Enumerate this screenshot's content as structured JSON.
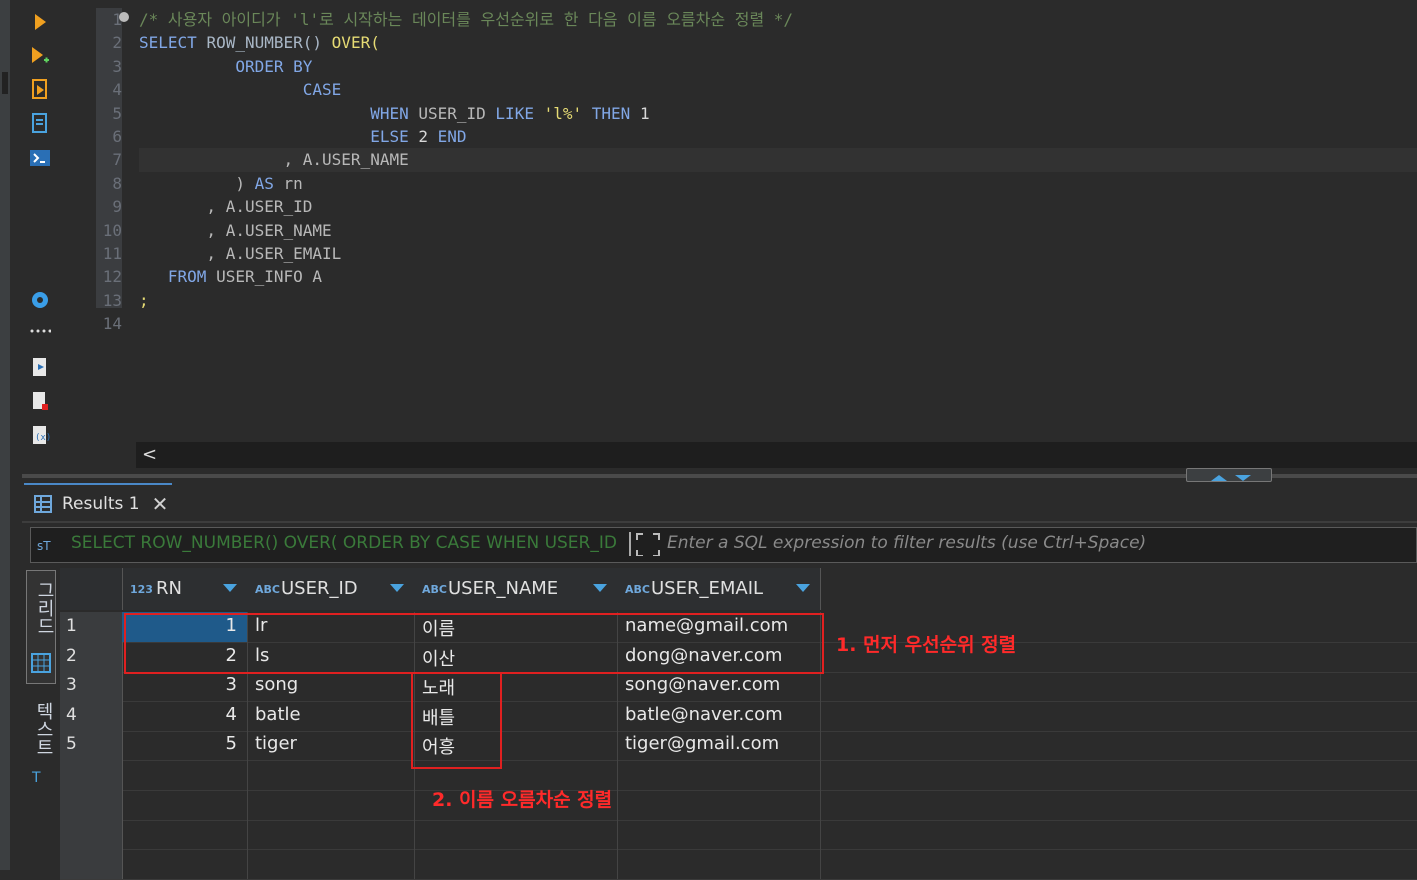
{
  "editor": {
    "lines": [
      {
        "n": "1",
        "parts": [
          {
            "c": "cm",
            "t": "/* 사용자 아이디가 'l'로 시작하는 데이터를 우선순위로 한 다음 이름 오름차순 정렬 */"
          }
        ]
      },
      {
        "n": "2",
        "parts": [
          {
            "c": "kw",
            "t": "SELECT "
          },
          {
            "c": "fn",
            "t": "ROW_NUMBER() "
          },
          {
            "c": "str",
            "t": "OVER("
          }
        ]
      },
      {
        "n": "3",
        "parts": [
          {
            "c": "txt",
            "t": "          "
          },
          {
            "c": "kw",
            "t": "ORDER BY"
          }
        ]
      },
      {
        "n": "4",
        "parts": [
          {
            "c": "txt",
            "t": "                 "
          },
          {
            "c": "kw",
            "t": "CASE"
          }
        ]
      },
      {
        "n": "5",
        "parts": [
          {
            "c": "txt",
            "t": "                        "
          },
          {
            "c": "kw",
            "t": "WHEN "
          },
          {
            "c": "txt",
            "t": "USER_ID "
          },
          {
            "c": "kw",
            "t": "LIKE "
          },
          {
            "c": "str",
            "t": "'l%' "
          },
          {
            "c": "kw",
            "t": "THEN "
          },
          {
            "c": "num",
            "t": "1"
          }
        ]
      },
      {
        "n": "6",
        "parts": [
          {
            "c": "txt",
            "t": "                        "
          },
          {
            "c": "kw",
            "t": "ELSE "
          },
          {
            "c": "num",
            "t": "2 "
          },
          {
            "c": "kw",
            "t": "END"
          }
        ]
      },
      {
        "n": "7",
        "parts": [
          {
            "c": "txt",
            "t": "               , A.USER_NAME"
          }
        ]
      },
      {
        "n": "8",
        "parts": [
          {
            "c": "txt",
            "t": "          ) "
          },
          {
            "c": "kw",
            "t": "AS "
          },
          {
            "c": "txt",
            "t": "rn"
          }
        ]
      },
      {
        "n": "9",
        "parts": [
          {
            "c": "txt",
            "t": "       , A.USER_ID"
          }
        ]
      },
      {
        "n": "10",
        "parts": [
          {
            "c": "txt",
            "t": "       , A.USER_NAME"
          }
        ]
      },
      {
        "n": "11",
        "parts": [
          {
            "c": "txt",
            "t": "       , A.USER_EMAIL"
          }
        ]
      },
      {
        "n": "12",
        "parts": [
          {
            "c": "txt",
            "t": "   "
          },
          {
            "c": "kw",
            "t": "FROM "
          },
          {
            "c": "txt",
            "t": "USER_INFO A"
          }
        ]
      },
      {
        "n": "13",
        "parts": [
          {
            "c": "str",
            "t": ";"
          }
        ]
      },
      {
        "n": "14",
        "parts": []
      }
    ]
  },
  "results": {
    "tab_label": "Results 1",
    "filter_sql": "SELECT ROW_NUMBER() OVER( ORDER BY CASE WHEN USER_ID",
    "filter_placeholder": "Enter a SQL expression to filter results (use Ctrl+Space)",
    "side_tab_grid": "그리드",
    "side_tab_text": "텍스트",
    "columns": [
      {
        "type": "123",
        "label": "RN"
      },
      {
        "type": "ABC",
        "label": "USER_ID"
      },
      {
        "type": "ABC",
        "label": "USER_NAME"
      },
      {
        "type": "ABC",
        "label": "USER_EMAIL"
      }
    ],
    "rows": [
      {
        "num": "1",
        "rn": "1",
        "user_id": "lr",
        "user_name": "이름",
        "user_email": "name@gmail.com"
      },
      {
        "num": "2",
        "rn": "2",
        "user_id": "ls",
        "user_name": "이산",
        "user_email": "dong@naver.com"
      },
      {
        "num": "3",
        "rn": "3",
        "user_id": "song",
        "user_name": "노래",
        "user_email": "song@naver.com"
      },
      {
        "num": "4",
        "rn": "4",
        "user_id": "batle",
        "user_name": "배틀",
        "user_email": "batle@naver.com"
      },
      {
        "num": "5",
        "rn": "5",
        "user_id": "tiger",
        "user_name": "어흥",
        "user_email": "tiger@gmail.com"
      }
    ]
  },
  "annotations": {
    "note1": "1. 먼저 우선순위 정렬",
    "note2": "2. 이름 오름차순 정렬"
  },
  "colors": {
    "annotation": "#ff2a2a",
    "accent": "#4aa3df"
  }
}
